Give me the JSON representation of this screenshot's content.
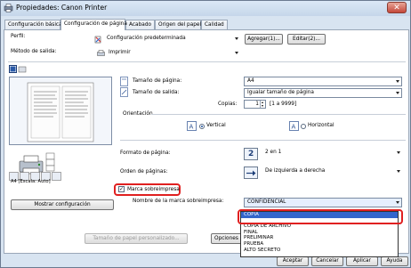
{
  "window": {
    "title": "Propiedades: Canon Printer",
    "close_label": "✕"
  },
  "tabs": [
    {
      "label": "Configuración básica"
    },
    {
      "label": "Configuración de página"
    },
    {
      "label": "Acabado"
    },
    {
      "label": "Origen del papel"
    },
    {
      "label": "Calidad"
    }
  ],
  "profile": {
    "perfil_label": "Perfil:",
    "perfil_value": "Configuración predeterminada",
    "add_button": "Agregar(1)...",
    "edit_button": "Editar(2)...",
    "output_label": "Método de salida:",
    "output_value": "Imprimir"
  },
  "page": {
    "page_size_label": "Tamaño de página:",
    "page_size_value": "A4",
    "output_size_label": "Tamaño de salida:",
    "output_size_value": "Igualar tamaño de página",
    "copies_label": "Copias:",
    "copies_value": "1",
    "copies_range": "[1 a 9999]",
    "orientation_label": "Orientación",
    "vertical_label": "Vertical",
    "horizontal_label": "Horizontal",
    "page_format_label": "Formato de página:",
    "page_format_value": "2 en 1",
    "page_format_number": "2",
    "page_order_label": "Orden de páginas:",
    "page_order_value": "De izquierda a derecha"
  },
  "preview": {
    "caption": "A4 [Escala: Auto]"
  },
  "watermark": {
    "checkbox_label": "Marca sobreimpresa",
    "checked": true,
    "name_label": "Nombre de la marca sobreimpresa:",
    "name_value": "CONFIDENCIAL",
    "options": [
      "COPIA",
      "COPIA DE ARCHIVO",
      "FINAL",
      "PRELIMINAR",
      "PRUEBA",
      "ALTO SECRETO"
    ],
    "selected_option": "COPIA"
  },
  "buttons": {
    "show_settings": "Mostrar configuración",
    "custom_paper": "Tamaño de papel personalizado...",
    "page_options": "Opciones de p",
    "accept": "Aceptar",
    "cancel": "Cancelar",
    "apply": "Aplicar",
    "help": "Ayuda"
  },
  "colors": {
    "accent": "#3366cc",
    "highlight_outline": "#e02020",
    "window_frame": "#d8e4f1"
  }
}
